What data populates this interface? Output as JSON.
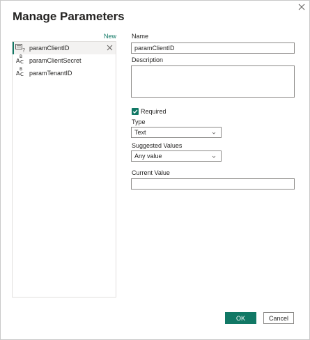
{
  "dialog": {
    "title": "Manage Parameters",
    "new_label": "New",
    "accent_color": "#117865"
  },
  "parameters": [
    {
      "name": "paramClientID",
      "icon": "any-type-parameter-icon",
      "selected": true
    },
    {
      "name": "paramClientSecret",
      "icon": "text-type-abc-icon",
      "selected": false
    },
    {
      "name": "paramTenantID",
      "icon": "text-type-abc-icon",
      "selected": false
    }
  ],
  "abc_icon": {
    "top": "B",
    "left": "A",
    "bottom": "C"
  },
  "form": {
    "name_label": "Name",
    "name_value": "paramClientID",
    "description_label": "Description",
    "description_value": "",
    "required_label": "Required",
    "required_checked": true,
    "type_label": "Type",
    "type_value": "Text",
    "suggested_label": "Suggested Values",
    "suggested_value": "Any value",
    "current_label": "Current Value",
    "current_value": ""
  },
  "buttons": {
    "ok": "OK",
    "cancel": "Cancel"
  }
}
